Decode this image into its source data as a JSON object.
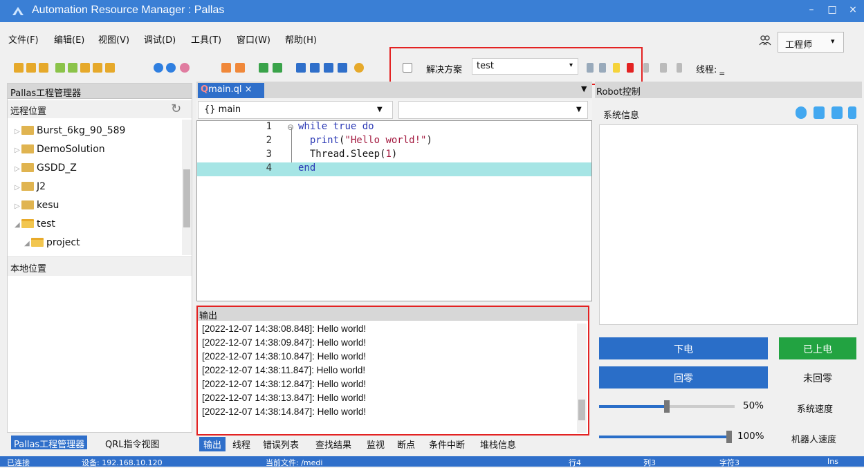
{
  "window": {
    "title": "Automation Resource Manager : Pallas",
    "min": "–",
    "max": "□",
    "close": "×"
  },
  "menu": [
    {
      "label": "文件(F)"
    },
    {
      "label": "编辑(E)"
    },
    {
      "label": "视图(V)"
    },
    {
      "label": "调试(D)"
    },
    {
      "label": "工具(T)"
    },
    {
      "label": "窗口(W)"
    },
    {
      "label": "帮助(H)"
    }
  ],
  "role": {
    "value": "工程师",
    "caret": "▾"
  },
  "toolbar": {
    "solution_label": "解决方案",
    "solution_value": "test",
    "solution_caret": "▾",
    "thread_label": "线程:",
    "thread_caret": "‗"
  },
  "left": {
    "header": "Pallas工程管理器",
    "remote": "远程位置",
    "tree": [
      {
        "label": "Burst_6kg_90_589",
        "arrow": "▷"
      },
      {
        "label": "DemoSolution",
        "arrow": "▷"
      },
      {
        "label": "GSDD_Z",
        "arrow": "▷"
      },
      {
        "label": "J2",
        "arrow": "▷"
      },
      {
        "label": "kesu",
        "arrow": "▷"
      },
      {
        "label": "test",
        "arrow": "◢"
      },
      {
        "label": "project",
        "arrow": "◢"
      }
    ],
    "local": "本地位置",
    "tabs": [
      "Pallas工程管理器",
      "QRL指令视图"
    ]
  },
  "editor": {
    "tab": "main.ql ×",
    "tab_prefix": "Q",
    "combo1": "{} main",
    "lines": [
      {
        "n": "1"
      },
      {
        "n": "2"
      },
      {
        "n": "3"
      },
      {
        "n": "4"
      }
    ],
    "code": {
      "l1_kw1": "while",
      "l1_kw2": "true",
      "l1_kw3": "do",
      "l2_fn": "print",
      "l2_open": "(",
      "l2_str": "\"Hello world!\"",
      "l2_close": ")",
      "l3_fn": "Thread.Sleep",
      "l3_open": "(",
      "l3_num": "1",
      "l3_close": ")",
      "l4_kw": "end"
    }
  },
  "output": {
    "header": "输出",
    "lines": [
      "[2022-12-07 14:38:08.848]: Hello world!",
      "[2022-12-07 14:38:09.847]: Hello world!",
      "[2022-12-07 14:38:10.847]: Hello world!",
      "[2022-12-07 14:38:11.847]: Hello world!",
      "[2022-12-07 14:38:12.847]: Hello world!",
      "[2022-12-07 14:38:13.847]: Hello world!",
      "[2022-12-07 14:38:14.847]: Hello world!"
    ],
    "tabs": [
      "输出",
      "线程",
      "错误列表",
      "查找结果",
      "监视",
      "断点",
      "条件中断",
      "堆栈信息"
    ]
  },
  "robot": {
    "header": "Robot控制",
    "sysinfo": "系统信息",
    "power_off": "下电",
    "power_on": "已上电",
    "home": "回零",
    "not_home": "未回零",
    "sys_speed_pct": "50%",
    "sys_speed_label": "系统速度",
    "robot_speed_pct": "100%",
    "robot_speed_label": "机器人速度",
    "sys_speed_value": 0.5,
    "robot_speed_value": 1.0
  },
  "status": {
    "connected": "已连接",
    "device": "设备: 192.168.10.120",
    "file": "当前文件: /medi",
    "row": "行4",
    "col": "列3",
    "char": "字符3",
    "ins": "Ins"
  },
  "colors": {
    "titlebar": "#3a7fd5",
    "accent": "#2f6fca",
    "highlight": "#e32222",
    "green": "#22a341"
  }
}
